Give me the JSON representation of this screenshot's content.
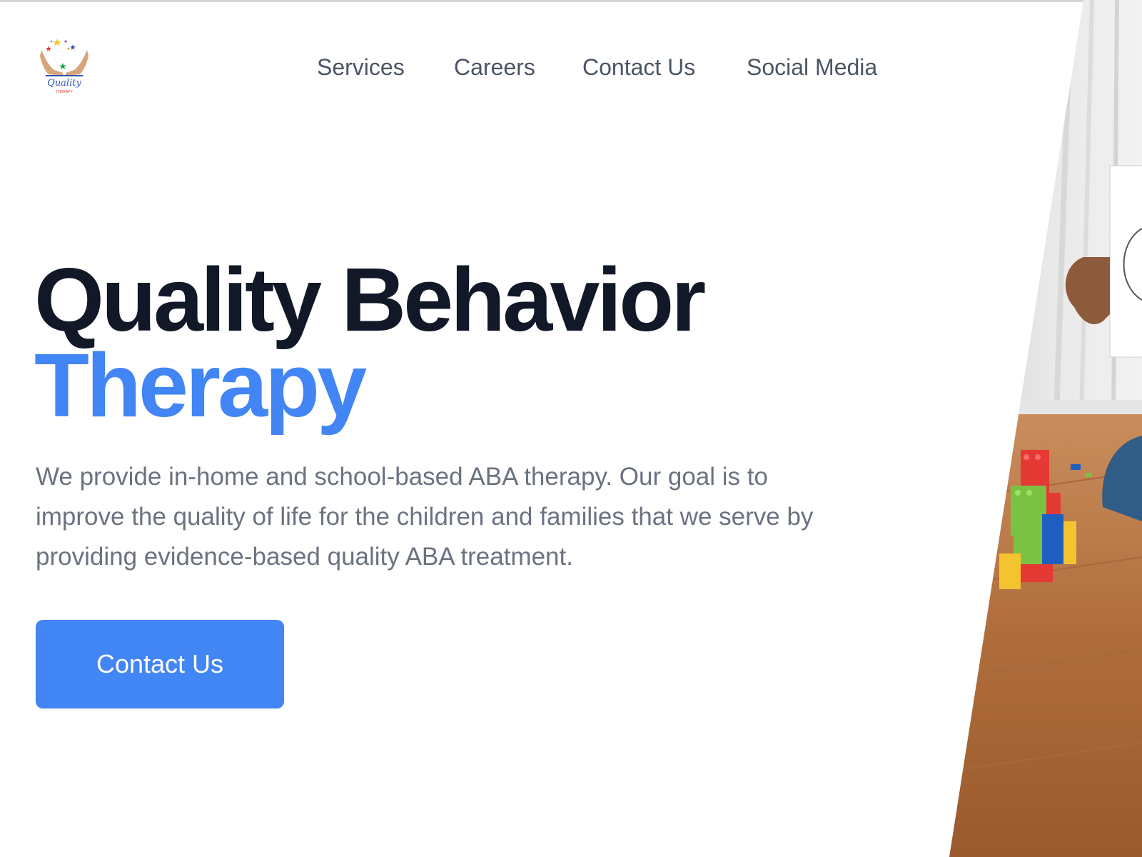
{
  "logo": {
    "alt": "Quality Behavior Therapy logo",
    "wordmark": "Quality",
    "subtext": "THERAPY"
  },
  "nav": {
    "items": [
      {
        "label": "Services"
      },
      {
        "label": "Careers"
      },
      {
        "label": "Contact Us"
      },
      {
        "label": "Social Media"
      }
    ]
  },
  "hero": {
    "title_line1": "Quality Behavior",
    "title_line2": "Therapy",
    "description": "We provide in-home and school-based ABA therapy. Our goal is to improve the quality of life for the children and families that we serve by providing evidence-based quality ABA treatment.",
    "cta_label": "Contact Us"
  },
  "colors": {
    "accent": "#4285f4",
    "heading": "#111827",
    "body_text": "#6b7280",
    "nav_text": "#4b5563"
  },
  "photo": {
    "description": "child playing with colorful building blocks on wooden floor"
  }
}
